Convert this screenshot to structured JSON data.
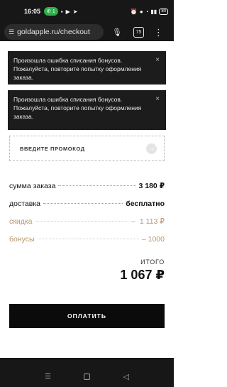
{
  "status_bar": {
    "time": "16:05",
    "call_badge": "1",
    "battery": "80"
  },
  "browser": {
    "url": "goldapple.ru/checkout",
    "tabs_count": "75"
  },
  "toasts": [
    {
      "message": "Произошла ошибка списания бонусов. Пожалуйста, повторите попытку оформления заказа.",
      "close": "×"
    },
    {
      "message": "Произошла ошибка списания бонусов. Пожалуйста, повторите попытку оформления заказа.",
      "close": "×"
    }
  ],
  "promo": {
    "label": "ВВЕДИТЕ ПРОМОКОД",
    "arrow": "→"
  },
  "summary": {
    "order_sum_label": "сумма заказа",
    "order_sum_value": "3 180 ₽",
    "delivery_label": "доставка",
    "delivery_value": "бесплатно",
    "discount_label": "скидка",
    "discount_minus": "–",
    "discount_value": "1 113 ₽",
    "bonus_label": "бонусы",
    "bonus_value": "– 1000"
  },
  "total": {
    "label": "ИТОГО",
    "value": "1 067 ₽"
  },
  "pay_button": {
    "label": "ОПЛАТИТЬ"
  },
  "icons": {
    "status": [
      "message-icon",
      "youtube-icon",
      "telegram-icon",
      "alarm-icon",
      "location-icon",
      "wifi-icon",
      "signal-icon"
    ],
    "browser": [
      "site-settings-icon",
      "mic-icon",
      "more-vert-icon"
    ],
    "nav": [
      "recents-icon",
      "home-icon",
      "back-icon"
    ]
  }
}
